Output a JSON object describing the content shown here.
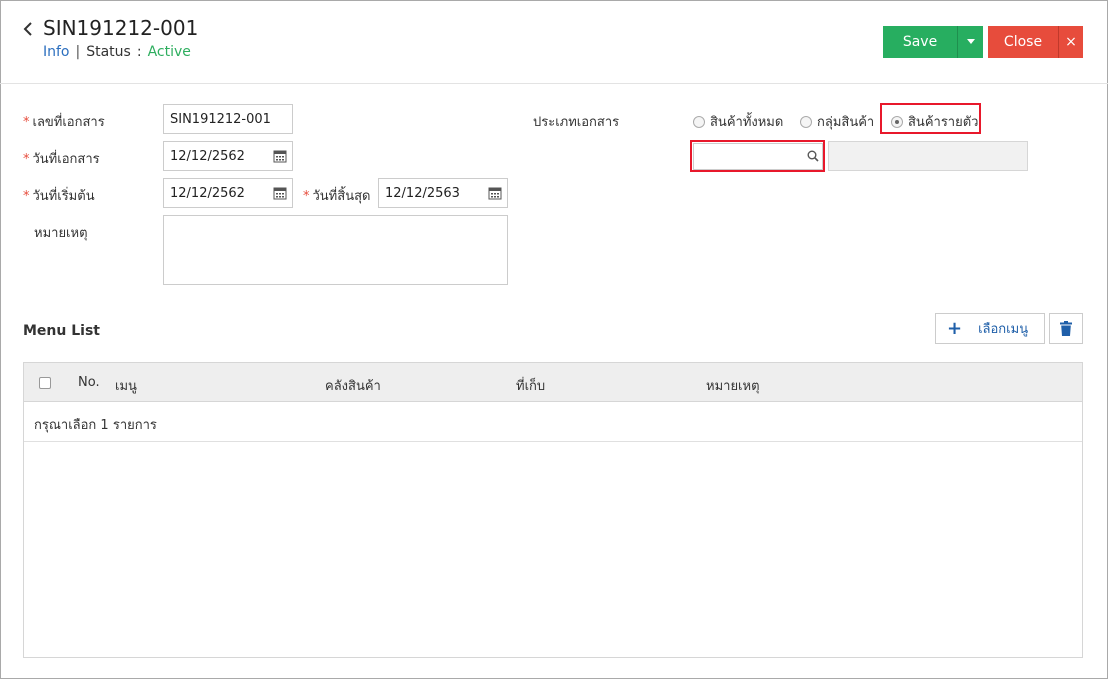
{
  "header": {
    "title": "SIN191212-001",
    "info_link": "Info",
    "separator": "|",
    "status_label": "Status",
    "status_colon": ":",
    "status_value": "Active",
    "save_label": "Save",
    "close_label": "Close",
    "close_x": "×"
  },
  "form": {
    "doc_no_label": "เลขที่เอกสาร",
    "doc_no_value": "SIN191212-001",
    "doc_date_label": "วันที่เอกสาร",
    "doc_date_value": "12/12/2562",
    "start_date_label": "วันที่เริ่มต้น",
    "start_date_value": "12/12/2562",
    "end_date_label": "วันที่สิ้นสุด",
    "end_date_value": "12/12/2563",
    "note_label": "หมายเหตุ",
    "note_value": "",
    "doc_type_label": "ประเภทเอกสาร",
    "doc_type_options": [
      "สินค้าทั้งหมด",
      "กลุ่มสินค้า",
      "สินค้ารายตัว"
    ],
    "doc_type_selected": "สินค้ารายตัว",
    "product_search_value": "",
    "product_name_value": ""
  },
  "menu_list": {
    "title": "Menu List",
    "select_menu_label": "เลือกเมนู",
    "columns": [
      "No.",
      "เมนู",
      "คลังสินค้า",
      "ที่เก็บ",
      "หมายเหตุ"
    ],
    "empty_message": "กรุณาเลือก 1 รายการ"
  },
  "colors": {
    "save": "#27ae60",
    "close": "#e74c3c",
    "highlight": "#e8182b",
    "link": "#2c6fbf",
    "status_active": "#2eae5f"
  },
  "icons": [
    "chevron-left-icon",
    "caret-down-icon",
    "calendar-icon",
    "search-icon",
    "plus-icon",
    "trash-icon"
  ]
}
